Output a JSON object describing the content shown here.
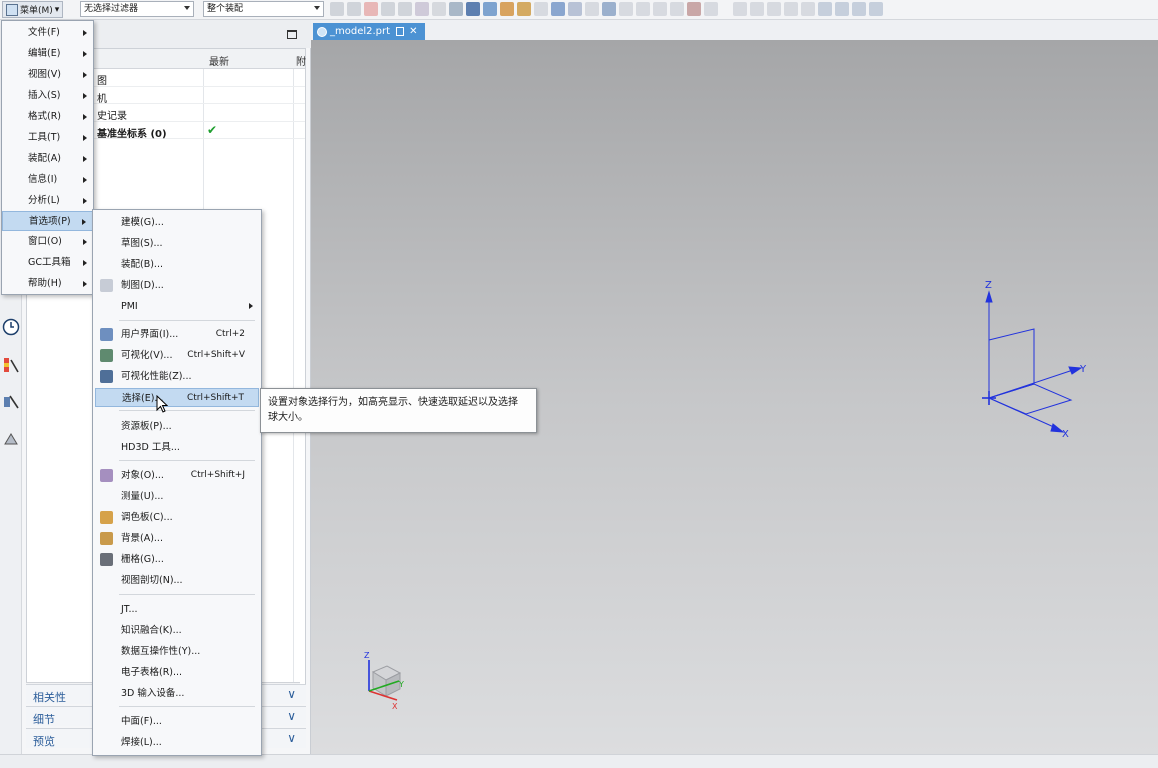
{
  "toolbar": {
    "menu_label": "菜单(M)",
    "filter_combo": "无选择过滤器",
    "scope_combo": "整个装配"
  },
  "navigator": {
    "col_latest": "最新",
    "col_extra": "附",
    "rows": [
      "图",
      "机",
      "史记录",
      "基准坐标系 (0)"
    ],
    "sections": [
      "相关性",
      "细节",
      "预览"
    ]
  },
  "tab": {
    "label": "_model2.prt"
  },
  "main_menu": [
    "文件(F)",
    "编辑(E)",
    "视图(V)",
    "插入(S)",
    "格式(R)",
    "工具(T)",
    "装配(A)",
    "信息(I)",
    "分析(L)",
    "首选项(P)",
    "窗口(O)",
    "GC工具箱",
    "帮助(H)"
  ],
  "submenu": {
    "items": [
      "建模(G)...",
      "草图(S)...",
      "装配(B)...",
      "制图(D)...",
      "PMI",
      "用户界面(I)...",
      "可视化(V)...",
      "可视化性能(Z)...",
      "选择(E)...",
      "资源板(P)...",
      "HD3D 工具...",
      "对象(O)...",
      "测量(U)...",
      "调色板(C)...",
      "背景(A)...",
      "栅格(G)...",
      "视图剖切(N)...",
      "JT...",
      "知识融合(K)...",
      "数据互操作性(Y)...",
      "电子表格(R)...",
      "3D 输入设备...",
      "中面(F)...",
      "焊接(L)..."
    ],
    "shortcuts": {
      "ui": "Ctrl+2",
      "vis": "Ctrl+Shift+V",
      "sel": "Ctrl+Shift+T",
      "obj": "Ctrl+Shift+J"
    }
  },
  "tooltip": "设置对象选择行为，如高亮显示、快速选取延迟以及选择\n球大小。",
  "triad": {
    "x": "X",
    "y": "Y",
    "z": "Z"
  },
  "colors": {
    "accent": "#4c92d3",
    "menu_highlight": "#c3daf1",
    "triad": "#2233dd"
  }
}
